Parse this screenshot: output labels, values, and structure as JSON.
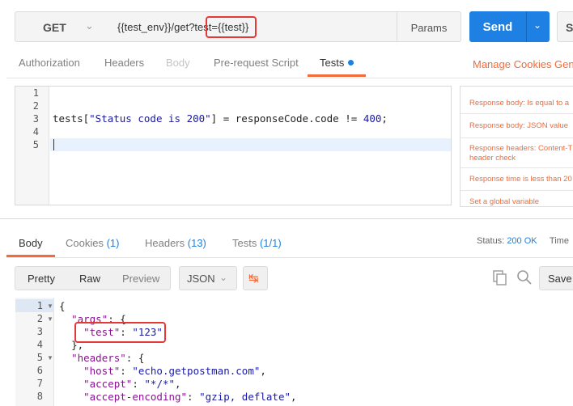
{
  "request": {
    "method": "GET",
    "url": "{{test_env}}/get?test={{test}}",
    "params_label": "Params",
    "send_label": "Send",
    "save_label": "Sa"
  },
  "request_tabs": {
    "authorization": "Authorization",
    "headers": "Headers",
    "body": "Body",
    "prerequest": "Pre-request Script",
    "tests": "Tests"
  },
  "links": {
    "manage_cookies": "Manage Cookies",
    "generate": "Gen"
  },
  "editor": {
    "line_numbers": [
      "1",
      "2",
      "3",
      "4",
      "5"
    ],
    "code_prefix": "tests[",
    "code_string": "\"Status code is 200\"",
    "code_middle": "] = responseCode.code != ",
    "code_number": "400",
    "code_suffix": ";"
  },
  "snippets": [
    "Response body: Is equal to a",
    "Response body: JSON value",
    "Response headers: Content-T",
    "header check",
    "Response time is less than 20",
    "Set a global variable"
  ],
  "response_tabs": {
    "body": "Body",
    "cookies": "Cookies",
    "cookies_count": "(1)",
    "headers": "Headers",
    "headers_count": "(13)",
    "tests": "Tests",
    "tests_count": "(1/1)"
  },
  "status": {
    "label": "Status:",
    "value": "200 OK",
    "time_label": "Time"
  },
  "response_toolbar": {
    "pretty": "Pretty",
    "raw": "Raw",
    "preview": "Preview",
    "language": "JSON",
    "save_response": "Save R"
  },
  "response_body": {
    "line_numbers": [
      "1",
      "2",
      "3",
      "4",
      "5",
      "6",
      "7",
      "8"
    ],
    "l1": "{",
    "l2_key": "\"args\"",
    "l2_rest": ": {",
    "l3_key": "\"test\"",
    "l3_sep": ": ",
    "l3_val": "\"123\"",
    "l4": "},",
    "l5_key": "\"headers\"",
    "l5_rest": ": {",
    "l6_key": "\"host\"",
    "l6_sep": ": ",
    "l6_val": "\"echo.getpostman.com\"",
    "l6_end": ",",
    "l7_key": "\"accept\"",
    "l7_sep": ": ",
    "l7_val": "\"*/*\"",
    "l7_end": ",",
    "l8_key": "\"accept-encoding\"",
    "l8_sep": ": ",
    "l8_val": "\"gzip, deflate\"",
    "l8_end": ","
  },
  "colors": {
    "accent_blue": "#1d80e2",
    "accent_orange": "#f26b3a",
    "highlight_red": "#e53935"
  },
  "icons": [
    "chevron-down-icon",
    "wrap-lines-icon",
    "copy-icon",
    "search-icon",
    "fold-arrow-icon"
  ]
}
